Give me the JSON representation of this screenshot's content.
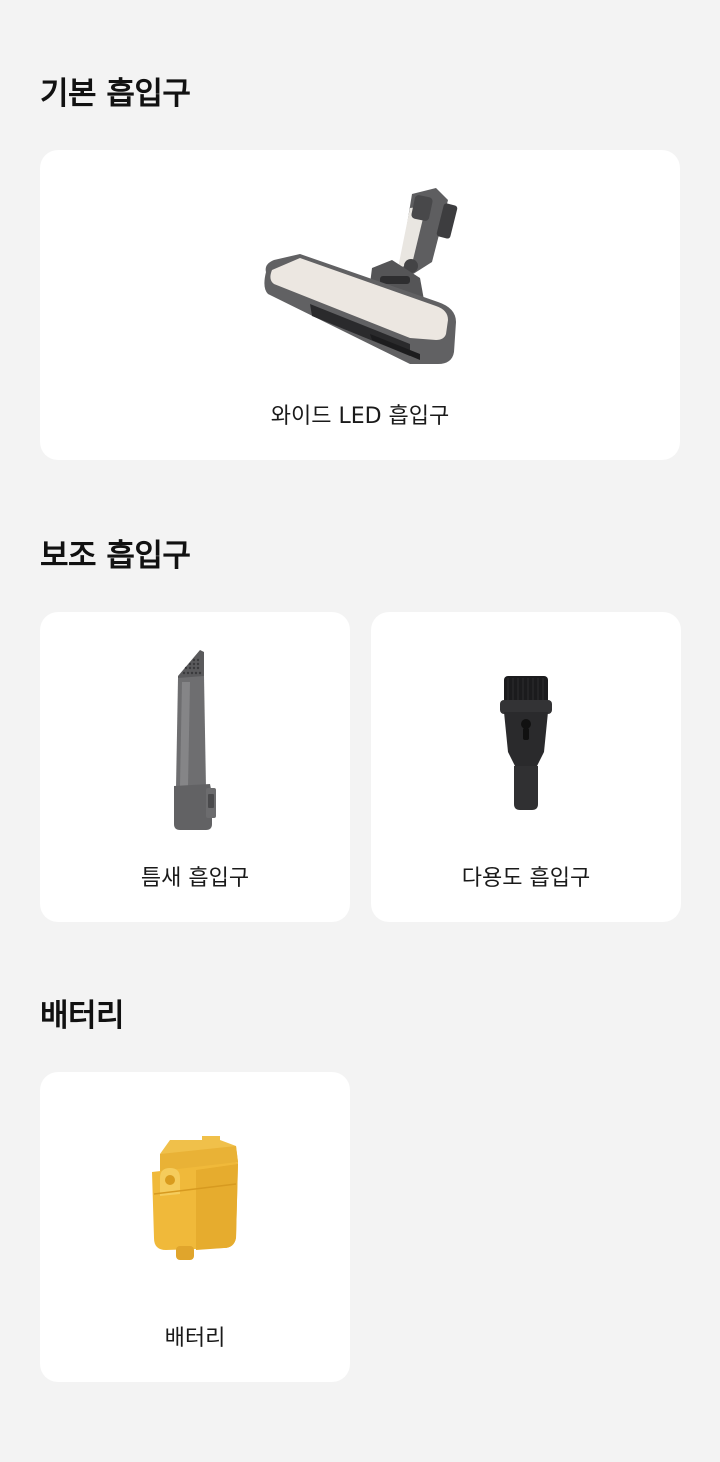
{
  "sections": [
    {
      "title": "기본 흡입구",
      "items": [
        {
          "label": "와이드 LED 흡입구",
          "icon": "wide-led-nozzle-icon"
        }
      ]
    },
    {
      "title": "보조 흡입구",
      "items": [
        {
          "label": "틈새 흡입구",
          "icon": "crevice-nozzle-icon"
        },
        {
          "label": "다용도 흡입구",
          "icon": "multi-purpose-nozzle-icon"
        }
      ]
    },
    {
      "title": "배터리",
      "items": [
        {
          "label": "배터리",
          "icon": "battery-icon"
        }
      ]
    }
  ],
  "colors": {
    "background": "#f3f3f3",
    "card": "#ffffff",
    "product_gray": "#6b6b6b",
    "battery_yellow": "#f2b93a"
  }
}
